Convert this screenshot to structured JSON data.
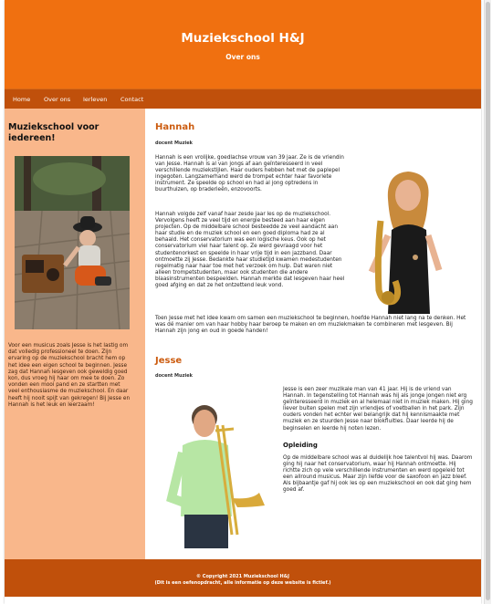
{
  "header": {
    "title": "Muziekschool H&J",
    "subtitle": "Over ons"
  },
  "nav": {
    "items": [
      "Home",
      "Over ons",
      "Ierleven",
      "Contact"
    ]
  },
  "sidebar": {
    "title": "Muziekschool voor iedereen!",
    "text": "Voor een musicus zoals Jesse is het lastig om dat volledig professioneel te doen. Zijn ervaring op de muziekschool bracht hem op het idee een eigen school te beginnen. Jesse zag dat Hannah lesgeven ook geweldig goed kon, dus vroeg hij haar om mee te doen. Zo vonden een mooi pand en ze startten met veel enthousiasme de muziekschool. En daar heeft hij nooit spijt van gekregen! Bij Jesse en Hannah is het leuk en leerzaam!"
  },
  "hannah": {
    "name": "Hannah",
    "role": "docent Muziek",
    "p1": "Hannah is een vrolijke, goedlachse vrouw van 39 jaar. Ze is de vriendin van Jesse. Hannah is al van jongs af aan geïnteresseerd in veel verschillende muziekstijlen. Haar ouders hebben het met de paplepel ingegoten. Langzamerhand werd de trompet echter haar favoriete instrument. Ze speelde op school en had al jong optredens in buurthuizen, op braderieën, enzovoorts.",
    "p2": "Hannah volgde zelf vanaf haar zesde jaar les op de muziekschool. Vervolgens heeft ze veel tijd en energie besteed aan haar eigen projecten. Op de middelbare school besteedde ze veel aandacht aan haar studie en de muziek school en een goed diploma had ze al behaald. Het conservatorium was een logische keus. Ook op het conservatorium viel haar talent op. Ze werd gevraagd voor het studentenorkest en speelde in haar vrije tijd in een jazzband. Daar ontmoette zij Jesse. Bedankte haar studietijd kwamen medestudenten regelmatig naar haar toe met het verzoek om hulp. Dat waren niet alleen trompetstudenten, maar ook studenten die andere blaasinstrumenten bespeelden. Hannah merkte dat lesgeven haar heel goed afging en dat ze het ontzettend leuk vond.",
    "p3": "Toen Jesse met het idee kwam om samen een muziekschool te beginnen, hoefde Hannah niet lang na te denken. Het was dé manier om van haar hobby haar beroep te maken en om muziekmaken te combineren met lesgeven. Bij Hannah zijn jong en oud in goede handen!"
  },
  "jesse": {
    "name": "Jesse",
    "role": "docent Muziek",
    "p1": "Jesse is een zeer muzikale man van 41 jaar. Hij is de vriend van Hannah. In tegenstelling tot Hannah was hij als jonge jongen niet erg geïnteresseerd in muziek en al helemaal niet in muziek maken. Hij ging liever buiten spelen met zijn vriendjes of voetballen in het park. Zijn ouders vonden het echter wel belangrijk dat hij kennismaakte met muziek en ze stuurden Jesse naar blokfluitles. Daar leerde hij de beginselen en leerde hij noten lezen.",
    "subheading": "Opleiding",
    "p2": "Op de middelbare school was al duidelijk hoe talentvol hij was. Daarom ging hij naar het conservatorium, waar hij Hannah ontmoette. Hij richtte zich op vele verschillende instrumenten en werd opgeleid tot een allround musicus. Maar zijn liefde voor de saxofoon en jazz bleef. Als bijbaantje gaf hij ook les op een muziekschool en ook dat ging hem goed af."
  },
  "footer": {
    "line1": "© Copyright 2021 Muziekschool H&J",
    "line2": "(Dit is een oefenopdracht, alle informatie op deze website is fictief.)"
  },
  "colors": {
    "header": "#f07010",
    "nav": "#c0500b",
    "sidebar": "#f9b78b",
    "accent": "#cc5c10"
  }
}
